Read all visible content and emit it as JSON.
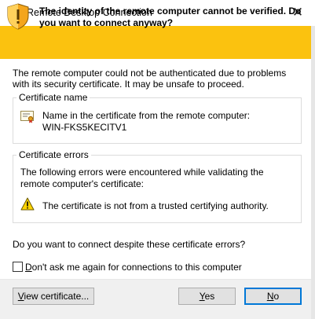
{
  "window": {
    "title": "Remote Desktop Connection",
    "close_glyph": "✕",
    "app_icon": "remote-desktop-icon"
  },
  "banner": {
    "message": "The identity of the remote computer cannot be verified. Do you want to connect anyway?",
    "background": "#fbc20f",
    "icon": "security-shield-warning-icon"
  },
  "intro": "The remote computer could not be authenticated due to problems with its security certificate. It may be unsafe to proceed.",
  "certificate_name": {
    "group_title": "Certificate name",
    "label": "Name in the certificate from the remote computer:",
    "value": "WIN-FKS5KECITV1",
    "icon": "certificate-icon"
  },
  "certificate_errors": {
    "group_title": "Certificate errors",
    "description": "The following errors were encountered while validating the remote computer's certificate:",
    "errors": [
      "The certificate is not from a trusted certifying authority."
    ],
    "icon": "warning-triangle-icon"
  },
  "question": "Do you want to connect despite these certificate errors?",
  "dont_ask": {
    "accel": "D",
    "label_rest": "on't ask me again for connections to this computer",
    "checked": false
  },
  "buttons": {
    "view_certificate": {
      "accel": "V",
      "rest": "iew certificate..."
    },
    "yes": {
      "accel": "Y",
      "rest": "es"
    },
    "no": {
      "accel": "N",
      "rest": "o"
    }
  },
  "colors": {
    "accent": "#0078d7",
    "footer": "#f0f0f0"
  }
}
